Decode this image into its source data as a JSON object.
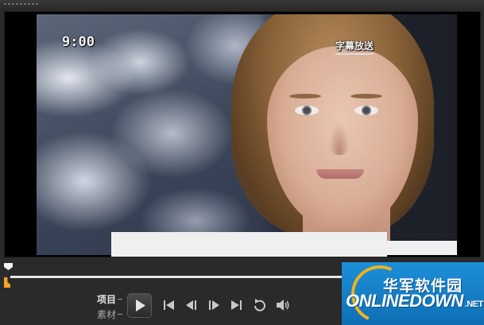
{
  "preview": {
    "clock_overlay": "9:00",
    "caption_overlay": "字幕放送"
  },
  "playback": {
    "mode_project": "项目",
    "mode_clip": "素材",
    "progress_fraction": 0.0
  },
  "watermark": {
    "cn_text": "华军软件园",
    "en_text": "ONLINEDOWN",
    "suffix": ".NET"
  },
  "colors": {
    "accent_orange": "#f5a42a",
    "watermark_blue": "#1c8fd8",
    "watermark_gold": "#f0b21c"
  },
  "icons": {
    "play": "play-icon",
    "previous": "skip-to-start-icon",
    "step_back": "step-back-icon",
    "step_forward": "step-forward-icon",
    "next": "skip-to-end-icon",
    "repeat": "repeat-icon",
    "volume": "volume-icon"
  }
}
